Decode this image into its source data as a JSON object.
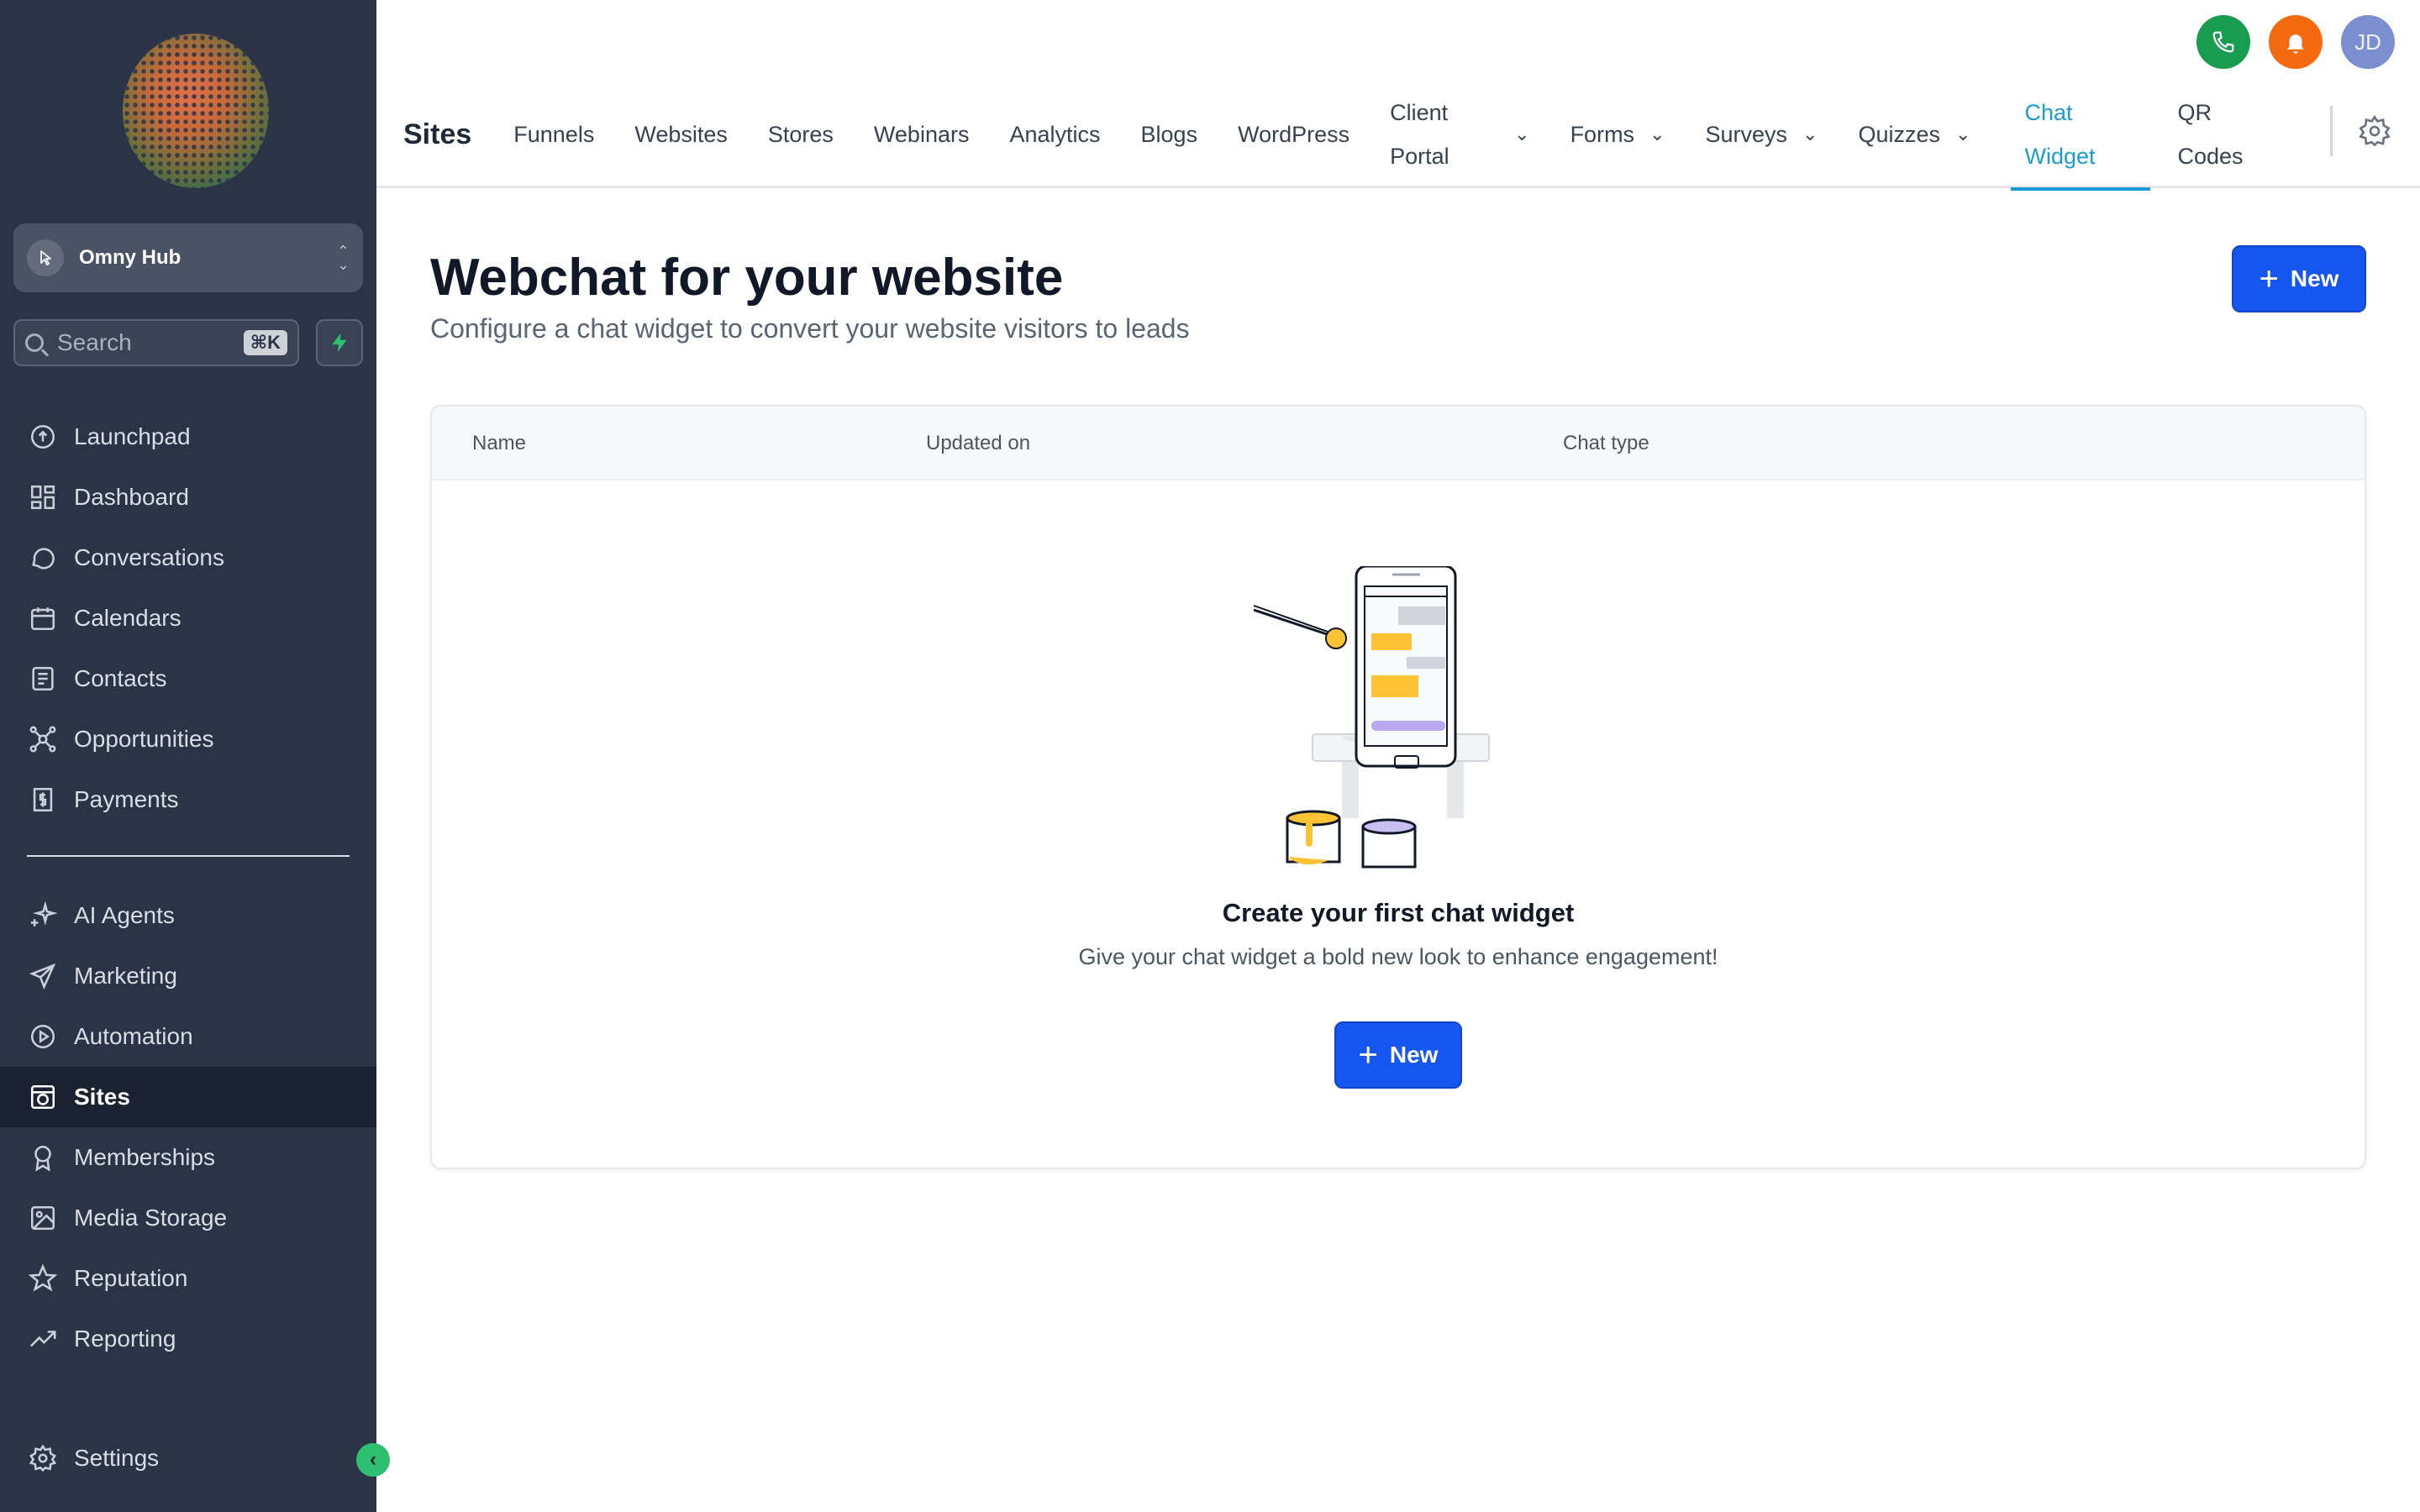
{
  "sidebar": {
    "workspace": "Omny Hub",
    "search_placeholder": "Search",
    "search_shortcut": "⌘K",
    "items_top": [
      {
        "label": "Launchpad",
        "icon": "launchpad-icon"
      },
      {
        "label": "Dashboard",
        "icon": "dashboard-icon"
      },
      {
        "label": "Conversations",
        "icon": "chat-bubble-icon"
      },
      {
        "label": "Calendars",
        "icon": "calendar-icon"
      },
      {
        "label": "Contacts",
        "icon": "contacts-icon"
      },
      {
        "label": "Opportunities",
        "icon": "opportunities-icon"
      },
      {
        "label": "Payments",
        "icon": "payments-icon"
      }
    ],
    "items_bottom": [
      {
        "label": "AI Agents",
        "icon": "sparkle-icon"
      },
      {
        "label": "Marketing",
        "icon": "send-icon"
      },
      {
        "label": "Automation",
        "icon": "automation-icon"
      },
      {
        "label": "Sites",
        "icon": "sites-icon",
        "active": true
      },
      {
        "label": "Memberships",
        "icon": "badge-icon"
      },
      {
        "label": "Media Storage",
        "icon": "image-icon"
      },
      {
        "label": "Reputation",
        "icon": "star-icon"
      },
      {
        "label": "Reporting",
        "icon": "trend-icon"
      }
    ],
    "settings": "Settings"
  },
  "header": {
    "section_title": "Sites",
    "avatar_initials": "JD",
    "tabs": {
      "funnels": "Funnels",
      "websites": "Websites",
      "stores": "Stores",
      "webinars": "Webinars",
      "analytics": "Analytics",
      "blogs": "Blogs",
      "wordpress": "WordPress",
      "client_portal": "Client Portal",
      "forms": "Forms",
      "surveys": "Surveys",
      "quizzes": "Quizzes",
      "chat_widget": "Chat Widget",
      "qr_codes": "QR Codes"
    }
  },
  "main": {
    "title": "Webchat for your website",
    "subtitle": "Configure a chat widget to convert your website visitors to leads",
    "new_label": "New",
    "columns": [
      "Name",
      "Updated on",
      "Chat type"
    ],
    "empty_title": "Create your first chat widget",
    "empty_subtitle": "Give your chat widget a bold new look to enhance engagement!",
    "empty_new_label": "New"
  },
  "colors": {
    "sidebar_bg": "#2b3447",
    "primary": "#1556f0",
    "active_tab": "#1a9ad6",
    "phone": "#189d4f",
    "bell": "#f56a0f"
  }
}
